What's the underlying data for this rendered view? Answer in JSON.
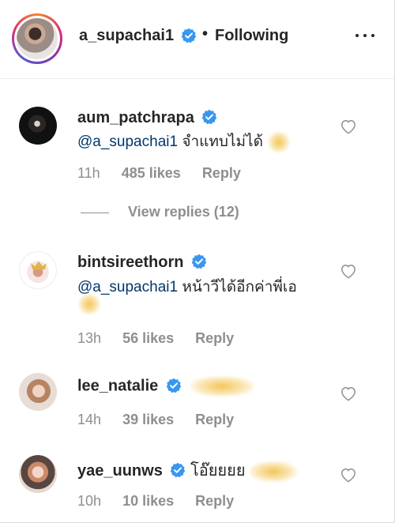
{
  "header": {
    "username": "a_supachai1",
    "separator": "•",
    "follow_status": "Following"
  },
  "comments": [
    {
      "username": "aum_patchrapa",
      "mention": "@a_supachai1",
      "text": " จำแทบไม่ได้",
      "time": "11h",
      "likes": "485 likes",
      "reply": "Reply"
    },
    {
      "username": "bintsireethorn",
      "mention": "@a_supachai1",
      "text": " หน้าวีได้อีกค่าพี่เอ",
      "time": "13h",
      "likes": "56 likes",
      "reply": "Reply"
    },
    {
      "username": "lee_natalie",
      "time": "14h",
      "likes": "39 likes",
      "reply": "Reply"
    },
    {
      "username": "yae_uunws",
      "text": "โอ๊ยยยย",
      "time": "10h",
      "likes": "10 likes",
      "reply": "Reply"
    }
  ],
  "view_replies": "View replies (12)",
  "colors": {
    "verified": "#3897f0",
    "mention": "#00376b",
    "meta": "#8e8e8e",
    "ring": "#dd2a7b"
  },
  "icons": [
    "verified-badge-icon",
    "more-options-icon",
    "heart-icon"
  ]
}
